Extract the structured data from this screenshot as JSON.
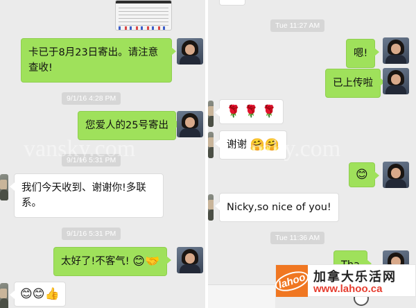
{
  "left": {
    "messages": [
      {
        "side": "me",
        "text": "卡已于8月23日寄出。请注意查收!"
      },
      {
        "type": "timestamp",
        "text": "9/1/16 4:28 PM"
      },
      {
        "side": "me",
        "text": "您爱人的25号寄出"
      },
      {
        "type": "timestamp",
        "text": "9/1/16 5:31 PM"
      },
      {
        "side": "other",
        "text": "我们今天收到、谢谢你!多联系。"
      },
      {
        "type": "timestamp",
        "text": "9/1/16 5:31 PM"
      },
      {
        "side": "me",
        "text": "太好了!不客气!",
        "emojis": [
          "😊",
          "🤝"
        ]
      },
      {
        "side": "other",
        "emojis": [
          "😊",
          "😊",
          "👍"
        ]
      }
    ]
  },
  "right": {
    "messages": [
      {
        "type": "timestamp",
        "text": "Tue 11:27 AM"
      },
      {
        "side": "me",
        "text": "嗯!"
      },
      {
        "side": "me",
        "text": "已上传啦"
      },
      {
        "side": "other",
        "emojis": [
          "🌹",
          "🌹",
          "🌹"
        ]
      },
      {
        "side": "other",
        "text": "谢谢",
        "emojis": [
          "🤗",
          "🤗"
        ]
      },
      {
        "side": "me",
        "emojis": [
          "😊"
        ]
      },
      {
        "side": "other",
        "text": "Nicky,so nice of you!"
      },
      {
        "type": "timestamp",
        "text": "Tue 11:36 AM"
      },
      {
        "side": "me",
        "text": "Tha"
      }
    ]
  },
  "watermark": "vansky.com",
  "logo": {
    "mark": "lahoo",
    "name": "加拿大乐活网",
    "url": "www.lahoo.ca"
  },
  "colors": {
    "my_bubble": "#9fe15b",
    "other_bubble": "#ffffff",
    "background": "#ebebeb",
    "logo_orange": "#f07722",
    "logo_red": "#e63d2f"
  }
}
